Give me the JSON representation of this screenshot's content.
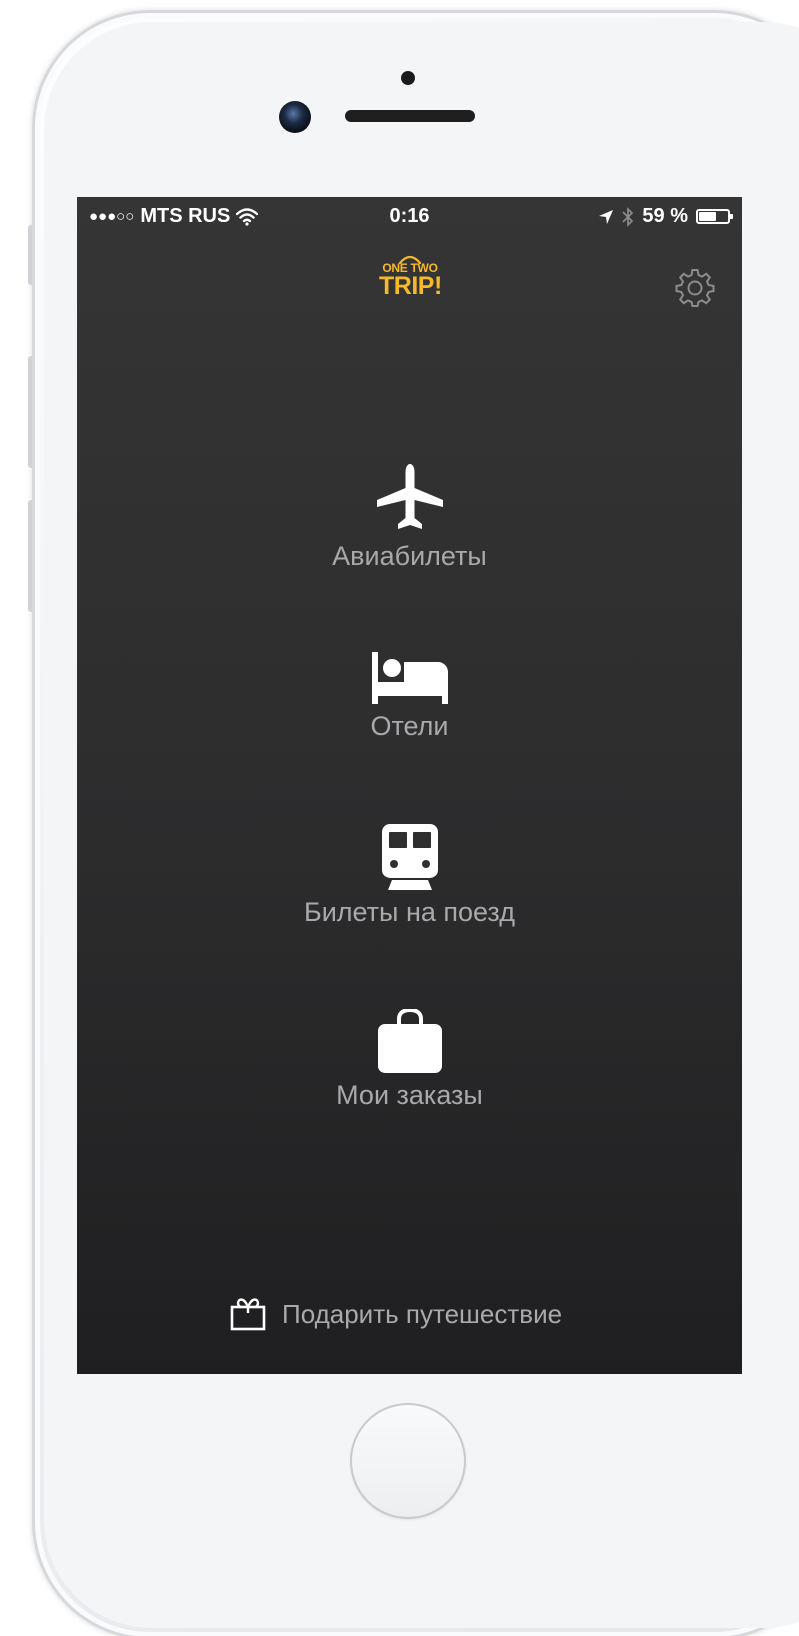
{
  "status_bar": {
    "signal": "●●●○○",
    "carrier": "MTS RUS",
    "wifi_icon": "wifi-icon",
    "time": "0:16",
    "location_icon": "location-arrow-icon",
    "bluetooth_icon": "bluetooth-icon",
    "battery_percent": "59 %",
    "battery_level": 0.59
  },
  "header": {
    "logo_top": "ONE TWO",
    "logo_bottom": "TRIP!",
    "logo_color": "#f5b92a",
    "settings_icon": "gear-icon"
  },
  "menu": {
    "items": [
      {
        "icon": "airplane-icon",
        "label": "Авиабилеты"
      },
      {
        "icon": "bed-icon",
        "label": "Отели"
      },
      {
        "icon": "train-icon",
        "label": "Билеты на поезд"
      },
      {
        "icon": "briefcase-icon",
        "label": "Мои заказы"
      }
    ]
  },
  "footer": {
    "gift_icon": "gift-icon",
    "gift_label": "Подарить путешествие"
  },
  "colors": {
    "screen_background": "#2f2f30",
    "label_color": "#a9a9ac",
    "icon_color": "#ffffff"
  }
}
